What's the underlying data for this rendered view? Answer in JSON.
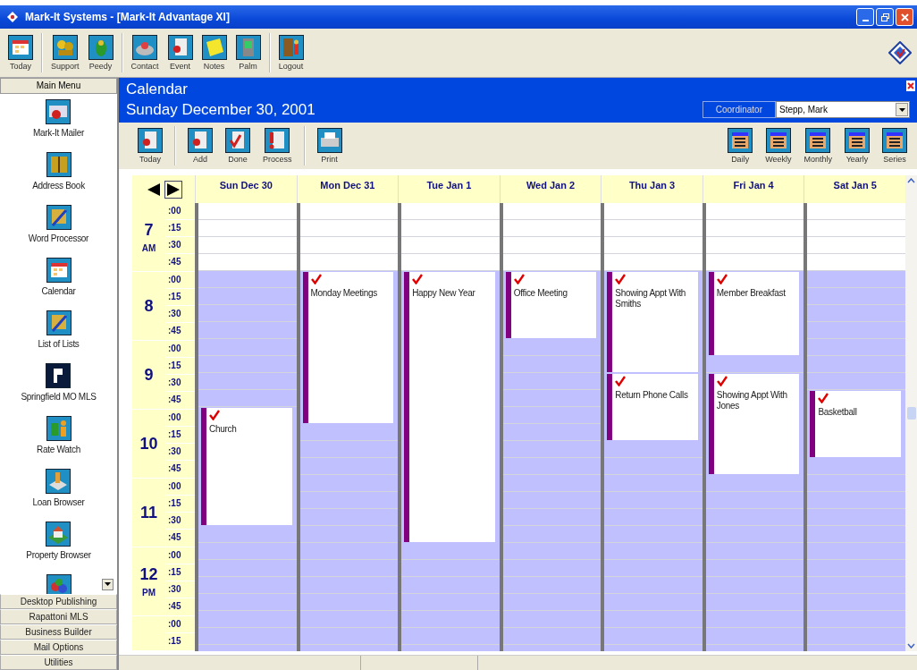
{
  "window": {
    "title": "Mark-It Systems - [Mark-It Advantage XI]"
  },
  "toolbar": {
    "groups": [
      {
        "items": [
          {
            "label": "Today"
          }
        ]
      },
      {
        "items": [
          {
            "label": "Support"
          },
          {
            "label": "Peedy"
          }
        ]
      },
      {
        "items": [
          {
            "label": "Contact"
          },
          {
            "label": "Event"
          },
          {
            "label": "Notes"
          },
          {
            "label": "Palm"
          }
        ]
      },
      {
        "items": [
          {
            "label": "Logout"
          }
        ]
      }
    ]
  },
  "sidebar": {
    "title": "Main Menu",
    "items": [
      {
        "label": "Mark-It Mailer"
      },
      {
        "label": "Address Book"
      },
      {
        "label": "Word Processor"
      },
      {
        "label": "Calendar"
      },
      {
        "label": "List of Lists"
      },
      {
        "label": "Springfield MO MLS"
      },
      {
        "label": "Rate Watch"
      },
      {
        "label": "Loan Browser"
      },
      {
        "label": "Property Browser"
      }
    ],
    "sections": [
      "Desktop Publishing",
      "Rapattoni MLS",
      "Business Builder",
      "Mail Options",
      "Utilities"
    ]
  },
  "calendar": {
    "title": "Calendar",
    "date": "Sunday December 30, 2001",
    "coordinator": {
      "label": "Coordinator",
      "value": "Stepp, Mark"
    },
    "actions": {
      "groups": [
        {
          "items": [
            {
              "label": "Today"
            }
          ]
        },
        {
          "items": [
            {
              "label": "Add"
            },
            {
              "label": "Done"
            },
            {
              "label": "Process"
            }
          ]
        },
        {
          "items": [
            {
              "label": "Print"
            }
          ]
        }
      ]
    },
    "views": [
      {
        "label": "Daily"
      },
      {
        "label": "Weekly"
      },
      {
        "label": "Monthly"
      },
      {
        "label": "Yearly"
      },
      {
        "label": "Series"
      }
    ],
    "hours": [
      {
        "hour": "7",
        "period": "AM",
        "working": false,
        "minutes": [
          ":00",
          ":15",
          ":30",
          ":45"
        ]
      },
      {
        "hour": "8",
        "working": true,
        "minutes": [
          ":00",
          ":15",
          ":30",
          ":45"
        ]
      },
      {
        "hour": "9",
        "working": true,
        "minutes": [
          ":00",
          ":15",
          ":30",
          ":45"
        ]
      },
      {
        "hour": "10",
        "working": true,
        "minutes": [
          ":00",
          ":15",
          ":30",
          ":45"
        ]
      },
      {
        "hour": "11",
        "working": true,
        "minutes": [
          ":00",
          ":15",
          ":30",
          ":45"
        ]
      },
      {
        "hour": "12",
        "period": "PM",
        "working": true,
        "minutes": [
          ":00",
          ":15",
          ":30",
          ":45"
        ]
      },
      {
        "working": true,
        "minutes": [
          ":00",
          ":15"
        ]
      }
    ],
    "days": [
      {
        "label": "Sun Dec 30",
        "slots": [
          {
            "kind": "free"
          },
          {
            "kind": "free"
          },
          {
            "kind": "free"
          },
          {
            "kind": "free"
          },
          {
            "kind": "free"
          },
          {
            "kind": "free"
          },
          {
            "kind": "free"
          },
          {
            "kind": "free"
          },
          {
            "kind": "free"
          },
          {
            "kind": "free"
          },
          {
            "kind": "free"
          },
          {
            "kind": "free"
          },
          {
            "kind": "event",
            "title": "Church",
            "done": true
          },
          {
            "kind": "more"
          },
          {
            "kind": "more"
          },
          {
            "kind": "more"
          },
          {
            "kind": "more"
          },
          {
            "kind": "more"
          },
          {
            "kind": "more"
          },
          {
            "kind": "free"
          },
          {
            "kind": "free"
          },
          {
            "kind": "free"
          },
          {
            "kind": "free"
          },
          {
            "kind": "free"
          },
          {
            "kind": "free"
          },
          {
            "kind": "free"
          }
        ]
      },
      {
        "label": "Mon Dec 31",
        "slots": [
          {
            "kind": "free"
          },
          {
            "kind": "free"
          },
          {
            "kind": "free"
          },
          {
            "kind": "free"
          },
          {
            "kind": "event",
            "title": "Monday Meetings",
            "done": true
          },
          {
            "kind": "more"
          },
          {
            "kind": "more"
          },
          {
            "kind": "more"
          },
          {
            "kind": "more"
          },
          {
            "kind": "more"
          },
          {
            "kind": "more"
          },
          {
            "kind": "more"
          },
          {
            "kind": "more"
          },
          {
            "kind": "free"
          },
          {
            "kind": "free"
          },
          {
            "kind": "free"
          },
          {
            "kind": "free"
          },
          {
            "kind": "free"
          },
          {
            "kind": "free"
          },
          {
            "kind": "free"
          },
          {
            "kind": "free"
          },
          {
            "kind": "free"
          },
          {
            "kind": "free"
          },
          {
            "kind": "free"
          },
          {
            "kind": "free"
          },
          {
            "kind": "free"
          }
        ]
      },
      {
        "label": "Tue Jan 1",
        "slots": [
          {
            "kind": "free"
          },
          {
            "kind": "free"
          },
          {
            "kind": "free"
          },
          {
            "kind": "free"
          },
          {
            "kind": "event",
            "title": "Happy New Year",
            "done": true
          },
          {
            "kind": "more"
          },
          {
            "kind": "more"
          },
          {
            "kind": "more"
          },
          {
            "kind": "more"
          },
          {
            "kind": "more"
          },
          {
            "kind": "more"
          },
          {
            "kind": "more"
          },
          {
            "kind": "more"
          },
          {
            "kind": "more"
          },
          {
            "kind": "more"
          },
          {
            "kind": "more"
          },
          {
            "kind": "more"
          },
          {
            "kind": "more"
          },
          {
            "kind": "more"
          },
          {
            "kind": "more"
          },
          {
            "kind": "free"
          },
          {
            "kind": "free"
          },
          {
            "kind": "free"
          },
          {
            "kind": "free"
          },
          {
            "kind": "free"
          },
          {
            "kind": "free"
          }
        ]
      },
      {
        "label": "Wed Jan 2",
        "slots": [
          {
            "kind": "free"
          },
          {
            "kind": "free"
          },
          {
            "kind": "free"
          },
          {
            "kind": "free"
          },
          {
            "kind": "event",
            "title": "Office Meeting",
            "done": true
          },
          {
            "kind": "more"
          },
          {
            "kind": "more"
          },
          {
            "kind": "more"
          },
          {
            "kind": "free"
          },
          {
            "kind": "free"
          },
          {
            "kind": "free"
          },
          {
            "kind": "free"
          },
          {
            "kind": "free"
          },
          {
            "kind": "free"
          },
          {
            "kind": "free"
          },
          {
            "kind": "free"
          },
          {
            "kind": "free"
          },
          {
            "kind": "free"
          },
          {
            "kind": "free"
          },
          {
            "kind": "free"
          },
          {
            "kind": "free"
          },
          {
            "kind": "free"
          },
          {
            "kind": "free"
          },
          {
            "kind": "free"
          },
          {
            "kind": "free"
          },
          {
            "kind": "free"
          }
        ]
      },
      {
        "label": "Thu Jan 3",
        "slots": [
          {
            "kind": "free"
          },
          {
            "kind": "free"
          },
          {
            "kind": "free"
          },
          {
            "kind": "free"
          },
          {
            "kind": "event",
            "title": "Showing Appt With Smiths",
            "done": true
          },
          {
            "kind": "more"
          },
          {
            "kind": "more"
          },
          {
            "kind": "more"
          },
          {
            "kind": "more"
          },
          {
            "kind": "more"
          },
          {
            "kind": "event",
            "title": "Return Phone Calls",
            "done": true
          },
          {
            "kind": "more"
          },
          {
            "kind": "more"
          },
          {
            "kind": "more"
          },
          {
            "kind": "free"
          },
          {
            "kind": "free"
          },
          {
            "kind": "free"
          },
          {
            "kind": "free"
          },
          {
            "kind": "free"
          },
          {
            "kind": "free"
          },
          {
            "kind": "free"
          },
          {
            "kind": "free"
          },
          {
            "kind": "free"
          },
          {
            "kind": "free"
          },
          {
            "kind": "free"
          },
          {
            "kind": "free"
          }
        ]
      },
      {
        "label": "Fri Jan 4",
        "slots": [
          {
            "kind": "free"
          },
          {
            "kind": "free"
          },
          {
            "kind": "free"
          },
          {
            "kind": "free"
          },
          {
            "kind": "event",
            "title": "Member Breakfast",
            "done": true
          },
          {
            "kind": "more"
          },
          {
            "kind": "more"
          },
          {
            "kind": "more"
          },
          {
            "kind": "more"
          },
          {
            "kind": "free"
          },
          {
            "kind": "event",
            "title": "Showing Appt With Jones",
            "done": true
          },
          {
            "kind": "more"
          },
          {
            "kind": "more"
          },
          {
            "kind": "more"
          },
          {
            "kind": "more"
          },
          {
            "kind": "more"
          },
          {
            "kind": "free"
          },
          {
            "kind": "free"
          },
          {
            "kind": "free"
          },
          {
            "kind": "free"
          },
          {
            "kind": "free"
          },
          {
            "kind": "free"
          },
          {
            "kind": "free"
          },
          {
            "kind": "free"
          },
          {
            "kind": "free"
          },
          {
            "kind": "free"
          }
        ]
      },
      {
        "label": "Sat Jan 5",
        "slots": [
          {
            "kind": "free"
          },
          {
            "kind": "free"
          },
          {
            "kind": "free"
          },
          {
            "kind": "free"
          },
          {
            "kind": "free"
          },
          {
            "kind": "free"
          },
          {
            "kind": "free"
          },
          {
            "kind": "free"
          },
          {
            "kind": "free"
          },
          {
            "kind": "free"
          },
          {
            "kind": "free"
          },
          {
            "kind": "event",
            "title": "Basketball",
            "done": true
          },
          {
            "kind": "more"
          },
          {
            "kind": "more"
          },
          {
            "kind": "more"
          },
          {
            "kind": "free"
          },
          {
            "kind": "free"
          },
          {
            "kind": "free"
          },
          {
            "kind": "free"
          },
          {
            "kind": "free"
          },
          {
            "kind": "free"
          },
          {
            "kind": "free"
          },
          {
            "kind": "free"
          },
          {
            "kind": "free"
          },
          {
            "kind": "free"
          },
          {
            "kind": "free"
          }
        ]
      }
    ]
  }
}
